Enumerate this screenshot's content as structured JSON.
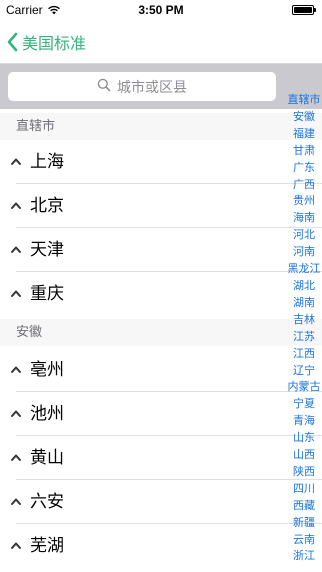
{
  "status": {
    "carrier": "Carrier",
    "time": "3:50 PM"
  },
  "nav": {
    "back_label": "美国标准"
  },
  "search": {
    "placeholder": "城市或区县"
  },
  "sections": [
    {
      "header": "直辖市",
      "items": [
        "上海",
        "北京",
        "天津",
        "重庆"
      ]
    },
    {
      "header": "安徽",
      "items": [
        "亳州",
        "池州",
        "黄山",
        "六安",
        "芜湖"
      ]
    }
  ],
  "index": [
    "直辖市",
    "安徽",
    "福建",
    "甘肃",
    "广东",
    "广西",
    "贵州",
    "海南",
    "河北",
    "河南",
    "黑龙江",
    "湖北",
    "湖南",
    "吉林",
    "江苏",
    "江西",
    "辽宁",
    "内蒙古",
    "宁夏",
    "青海",
    "山东",
    "山西",
    "陕西",
    "四川",
    "西藏",
    "新疆",
    "云南",
    "浙江"
  ],
  "colors": {
    "accent": "#36b37e",
    "index": "#1a74e0",
    "header_bg": "#f7f7f7",
    "search_bar_bg": "#c9c9ce"
  }
}
